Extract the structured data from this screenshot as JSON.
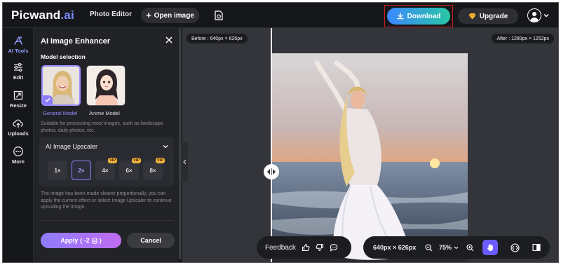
{
  "app": {
    "logo_main": "Picwand",
    "logo_suffix": ".ai",
    "nav_photo_editor": "Photo Editor",
    "open_image_label": "Open image",
    "download_label": "Download",
    "upgrade_label": "Upgrade"
  },
  "rail": {
    "items": [
      {
        "label": "AI Tools",
        "icon": "ai-tools-icon",
        "active": true
      },
      {
        "label": "Edit",
        "icon": "sliders-icon"
      },
      {
        "label": "Resize",
        "icon": "resize-icon"
      },
      {
        "label": "Uploads",
        "icon": "upload-cloud-icon"
      },
      {
        "label": "More",
        "icon": "more-icon"
      }
    ]
  },
  "panel": {
    "title": "AI Image Enhancer",
    "model_selection": "Model selection",
    "models": [
      {
        "label": "General Model",
        "selected": true
      },
      {
        "label": "Anime Model",
        "selected": false
      }
    ],
    "description": "Suitable for processing most images, such as landscape photos, daily photos, etc.",
    "upscaler_title": "AI Image Upscaler",
    "scales": [
      {
        "label": "1×",
        "vip": ""
      },
      {
        "label": "2×",
        "vip": "",
        "active": true
      },
      {
        "label": "4×",
        "vip": "VIP"
      },
      {
        "label": "6×",
        "vip": "VIP"
      },
      {
        "label": "8×",
        "vip": "VIP"
      }
    ],
    "info": "The image has been made clearer proportionally, you can apply the current effect or select Image Upscaler to continue upscaling the image.",
    "apply_label": "Apply",
    "apply_cost": "( -2",
    "apply_cost_end": ")",
    "cancel_label": "Cancel"
  },
  "canvas": {
    "before_label": "Before : 640px × 626px",
    "after_label": "After : 1280px × 1252px"
  },
  "feedback": {
    "label": "Feedback"
  },
  "view": {
    "dimensions": "640px × 626px",
    "zoom": "75%"
  },
  "colors": {
    "accent": "#8f84ff",
    "download_gradient_start": "#3d88ff",
    "download_gradient_end": "#27c7a4",
    "highlight_frame": "#d21f1f"
  }
}
